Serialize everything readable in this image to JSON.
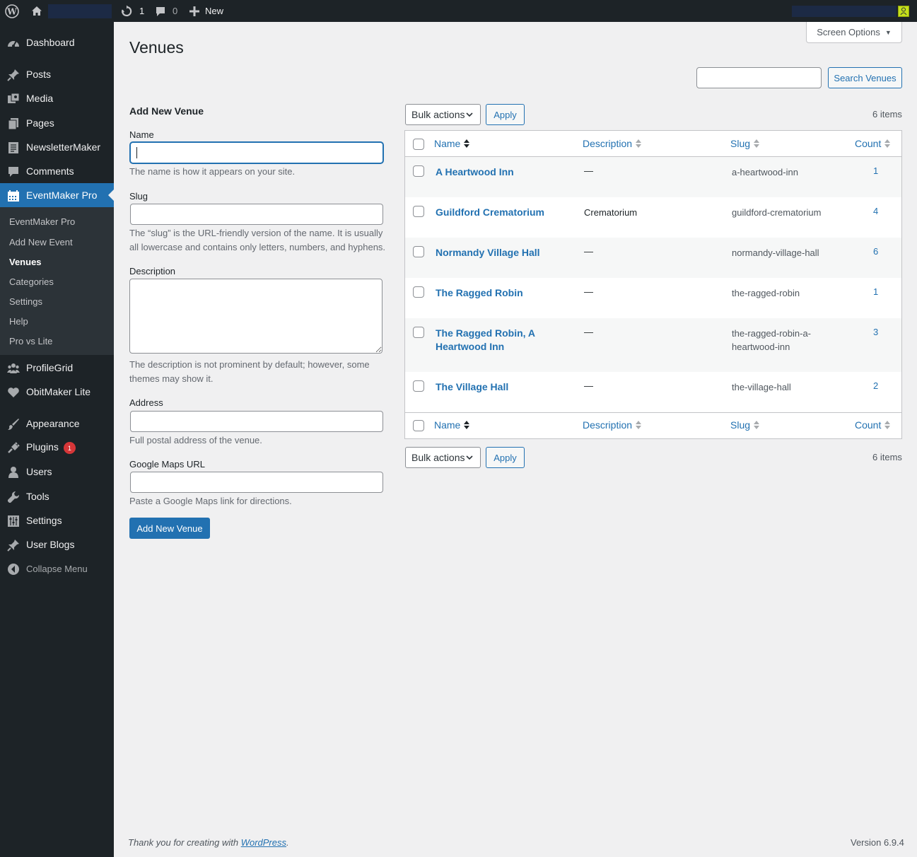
{
  "adminbar": {
    "updates_count": "1",
    "comments_count": "0",
    "new_label": "New"
  },
  "sidebar": {
    "items": [
      {
        "label": "Dashboard",
        "icon": "dashboard-icon"
      },
      {
        "label": "Posts",
        "icon": "pin-icon"
      },
      {
        "label": "Media",
        "icon": "media-icon"
      },
      {
        "label": "Pages",
        "icon": "pages-icon"
      },
      {
        "label": "NewsletterMaker",
        "icon": "newsletter-icon"
      },
      {
        "label": "Comments",
        "icon": "comment-icon"
      },
      {
        "label": "EventMaker Pro",
        "icon": "calendar-icon"
      },
      {
        "label": "ProfileGrid",
        "icon": "groups-icon"
      },
      {
        "label": "ObitMaker Lite",
        "icon": "heart-icon"
      },
      {
        "label": "Appearance",
        "icon": "brush-icon"
      },
      {
        "label": "Plugins",
        "icon": "plugin-icon",
        "badge": "1"
      },
      {
        "label": "Users",
        "icon": "user-icon"
      },
      {
        "label": "Tools",
        "icon": "wrench-icon"
      },
      {
        "label": "Settings",
        "icon": "settings-icon"
      },
      {
        "label": "User Blogs",
        "icon": "pin-icon"
      },
      {
        "label": "Collapse Menu",
        "icon": "collapse-icon"
      }
    ],
    "submenu": [
      "EventMaker Pro",
      "Add New Event",
      "Venues",
      "Categories",
      "Settings",
      "Help",
      "Pro vs Lite"
    ]
  },
  "page": {
    "title": "Venues",
    "screen_options": "Screen Options",
    "search_button": "Search Venues"
  },
  "form": {
    "heading": "Add New Venue",
    "name_label": "Name",
    "name_help": "The name is how it appears on your site.",
    "slug_label": "Slug",
    "slug_help_1": "The “slug” is the URL-friendly version of the name. It is usually",
    "slug_help_2": "all lowercase and contains only letters, numbers, and hyphens.",
    "description_label": "Description",
    "description_help_1": "The description is not prominent by default; however, some",
    "description_help_2": "themes may show it.",
    "address_label": "Address",
    "address_help": "Full postal address of the venue.",
    "maps_label": "Google Maps URL",
    "maps_help": "Paste a Google Maps link for directions.",
    "submit": "Add New Venue"
  },
  "table": {
    "bulk_actions": "Bulk actions",
    "apply": "Apply",
    "items_count": "6 items",
    "columns": [
      "Name",
      "Description",
      "Slug",
      "Count"
    ],
    "rows": [
      {
        "name": "A Heartwood Inn",
        "description": "—",
        "slug": "a-heartwood-inn",
        "count": "1"
      },
      {
        "name": "Guildford Crematorium",
        "description": "Crematorium",
        "slug": "guildford-crematorium",
        "count": "4"
      },
      {
        "name": "Normandy Village Hall",
        "description": "—",
        "slug": "normandy-village-hall",
        "count": "6"
      },
      {
        "name": "The Ragged Robin",
        "description": "—",
        "slug": "the-ragged-robin",
        "count": "1"
      },
      {
        "name": "The Ragged Robin, A Heartwood Inn",
        "description": "—",
        "slug": "the-ragged-robin-a-heartwood-inn",
        "count": "3"
      },
      {
        "name": "The Village Hall",
        "description": "—",
        "slug": "the-village-hall",
        "count": "2"
      }
    ]
  },
  "footer": {
    "thanks_prefix": "Thank you for creating with ",
    "wordpress_link": "WordPress",
    "thanks_suffix": ".",
    "version": "Version 6.9.4"
  }
}
